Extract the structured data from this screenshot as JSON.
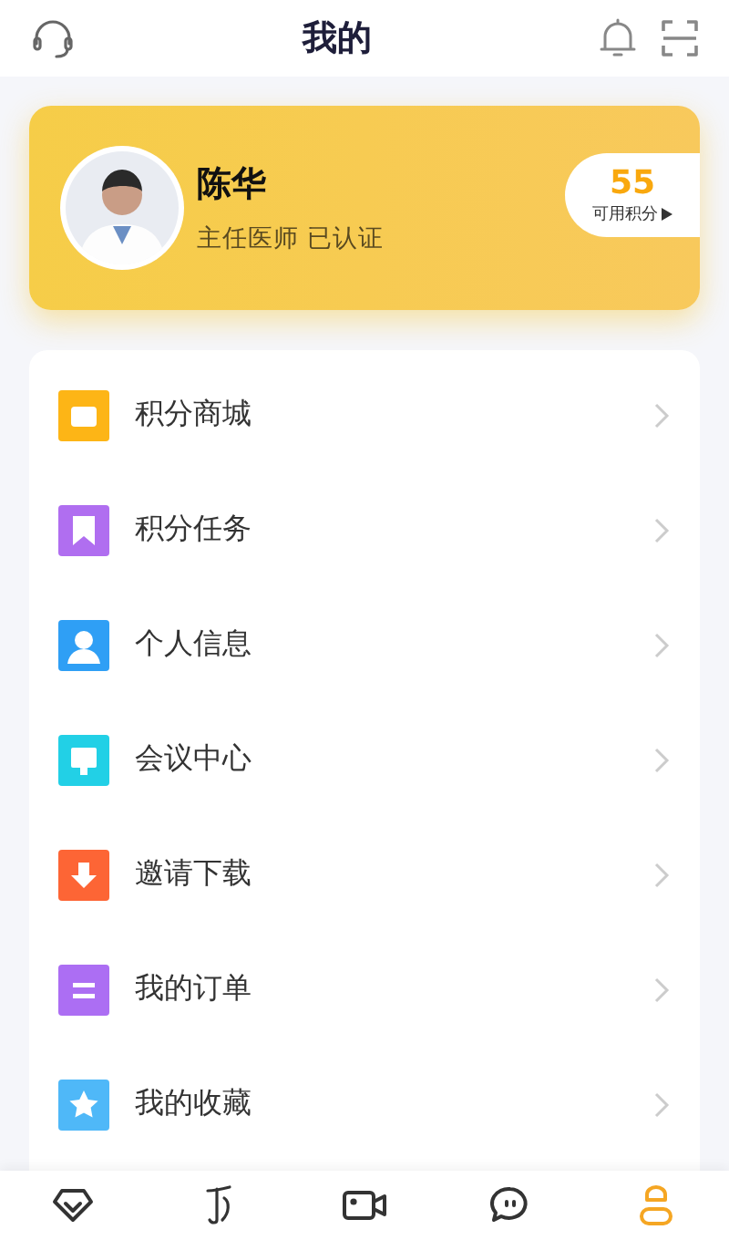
{
  "header": {
    "title": "我的"
  },
  "profile": {
    "name": "陈华",
    "subtitle": "主任医师 已认证",
    "points": "55",
    "points_label": "可用积分"
  },
  "menu": [
    {
      "label": "积分商城",
      "kind": "bag",
      "color": "#fdb516"
    },
    {
      "label": "积分任务",
      "kind": "bookmark",
      "color": "#b06ef0"
    },
    {
      "label": "个人信息",
      "kind": "person",
      "color": "#2f9ff5"
    },
    {
      "label": "会议中心",
      "kind": "screen",
      "color": "#22d0e6"
    },
    {
      "label": "邀请下载",
      "kind": "download",
      "color": "#fd6535"
    },
    {
      "label": "我的订单",
      "kind": "list",
      "color": "#ac6ef3"
    },
    {
      "label": "我的收藏",
      "kind": "star",
      "color": "#4fb8f8"
    }
  ],
  "tabs": [
    {
      "kind": "diamond",
      "selected": false
    },
    {
      "kind": "glyph",
      "selected": false
    },
    {
      "kind": "video",
      "selected": false
    },
    {
      "kind": "chat",
      "selected": false
    },
    {
      "kind": "user",
      "selected": true
    }
  ]
}
